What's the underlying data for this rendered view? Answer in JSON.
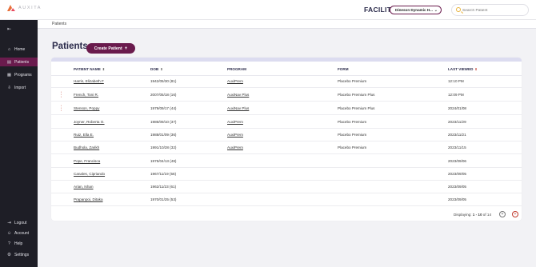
{
  "brand": {
    "name": "AUXITA"
  },
  "header": {
    "facility_label": "FACILITY",
    "facility_value": "Dineson Dynamic H...",
    "search_placeholder": "Search Patient"
  },
  "sidebar": {
    "items": [
      {
        "label": "Home",
        "icon": "home-icon",
        "glyph": "⌂",
        "active": false
      },
      {
        "label": "Patients",
        "icon": "patients-icon",
        "glyph": "▤",
        "active": true
      },
      {
        "label": "Programs",
        "icon": "programs-icon",
        "glyph": "▦",
        "active": false
      },
      {
        "label": "Import",
        "icon": "import-icon",
        "glyph": "⇩",
        "active": false
      }
    ],
    "bottom_items": [
      {
        "label": "Logout",
        "icon": "logout-icon",
        "glyph": "⇥"
      },
      {
        "label": "Account",
        "icon": "account-icon",
        "glyph": "☺"
      },
      {
        "label": "Help",
        "icon": "help-icon",
        "glyph": "?"
      },
      {
        "label": "Settings",
        "icon": "settings-icon",
        "glyph": "⚙"
      }
    ]
  },
  "breadcrumb": "Patients",
  "page": {
    "title": "Patients",
    "create_button": "Create Patient",
    "create_icon": "+"
  },
  "table": {
    "columns": [
      "PATIENT NAME",
      "DOB",
      "PROGRAM",
      "FORM",
      "LAST VIEWED"
    ],
    "rows": [
      {
        "name": "Harris, Elizabeth F",
        "dob": "1942/05/30 (81)",
        "program": "AuxiPrem",
        "form": "Placebo Premium",
        "last_viewed": "12:10 PM",
        "menu": false
      },
      {
        "name": "French, Toni R.",
        "dob": "2007/05/18 (16)",
        "program": "AuxiNav Plus",
        "form": "Placebo Premium Plus",
        "last_viewed": "12:09 PM",
        "menu": true
      },
      {
        "name": "Stenson, Poppy",
        "dob": "1979/09/17 (44)",
        "program": "AuxiNav Plus",
        "form": "Placebo Premium Plus",
        "last_viewed": "2024/01/08",
        "menu": true
      },
      {
        "name": "Joyner, Roberta O.",
        "dob": "1986/09/10 (37)",
        "program": "AuxiPrem",
        "form": "Placebo Premium",
        "last_viewed": "2023/11/29",
        "menu": false
      },
      {
        "name": "Ruiz, Ella E.",
        "dob": "1988/01/09 (36)",
        "program": "AuxiPrem",
        "form": "Placebo Premium",
        "last_viewed": "2023/11/21",
        "menu": false
      },
      {
        "name": "Budhola, Zarikh",
        "dob": "1991/10/28 (32)",
        "program": "AuxiPrem",
        "form": "Placebo Premium",
        "last_viewed": "2023/11/15",
        "menu": false
      },
      {
        "name": "Pope, Francisca",
        "dob": "1975/04/13 (48)",
        "program": "",
        "form": "",
        "last_viewed": "2023/09/06",
        "menu": false
      },
      {
        "name": "Canales, Cipriando",
        "dob": "1967/11/19 (56)",
        "program": "",
        "form": "",
        "last_viewed": "2023/09/05",
        "menu": false
      },
      {
        "name": "Arian, Ishan",
        "dob": "1962/11/23 (61)",
        "program": "",
        "form": "",
        "last_viewed": "2023/09/05",
        "menu": false
      },
      {
        "name": "Prapanpoi, Ditaka",
        "dob": "1970/01/25 (53)",
        "program": "",
        "form": "",
        "last_viewed": "2023/09/05",
        "menu": false
      }
    ]
  },
  "pagination": {
    "prefix": "Displaying:",
    "range": "1 - 10",
    "suffix": "of 14",
    "prev_glyph": "+",
    "next_glyph": "+"
  },
  "colors": {
    "accent": "#6a1b4d",
    "sidebar_bg": "#1e1e26",
    "alert": "#c0392b",
    "search_icon": "#e8b23a"
  }
}
